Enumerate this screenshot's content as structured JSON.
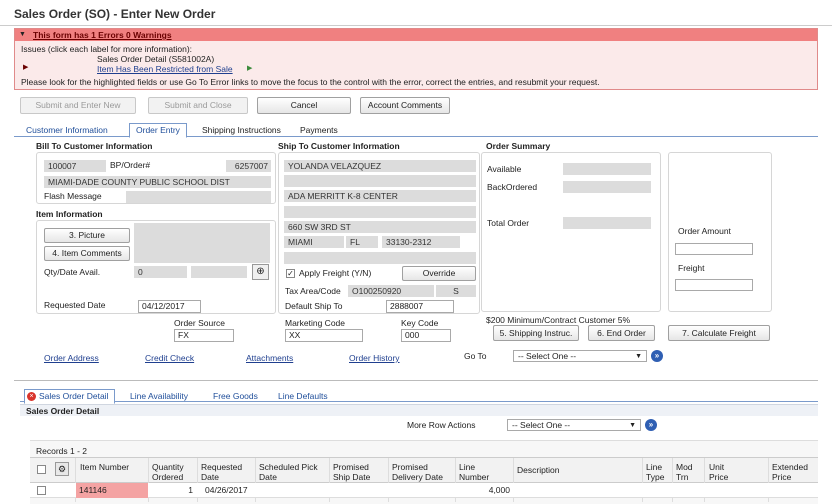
{
  "window": {
    "title": "Sales Order (SO) - Enter New Order"
  },
  "errors": {
    "banner": "This form has 1 Errors 0 Warnings",
    "issues_header": "Issues (click each label for more information):",
    "issue_title": "Sales Order Detail (S581002A)",
    "issue_link": "Item Has Been Restricted from Sale",
    "instruction": "Please look for the highlighted fields or use Go To Error links to move the focus to the control with the error, correct the entries, and resubmit your request."
  },
  "actions": {
    "submit_enter_new": "Submit and Enter New",
    "submit_close": "Submit and Close",
    "cancel": "Cancel",
    "account_comments": "Account Comments"
  },
  "tabs": [
    "Customer Information",
    "Order Entry",
    "Shipping Instructions",
    "Payments"
  ],
  "bill_to": {
    "header": "Bill To Customer Information",
    "customer_no": "100007",
    "bp_label": "BP/Order#",
    "bp_value": "6257007",
    "name": "MIAMI-DADE COUNTY PUBLIC SCHOOL DIST",
    "flash_label": "Flash Message"
  },
  "item_info": {
    "header": "Item Information",
    "picture_btn": "3. Picture",
    "item_comments_btn": "4. Item Comments",
    "qty_label": "Qty/Date Avail.",
    "qty_value": "0",
    "requested_label": "Requested Date",
    "requested_value": "04/12/2017"
  },
  "ship_to": {
    "header": "Ship To Customer Information",
    "name": "YOLANDA VELAZQUEZ",
    "line3": "ADA MERRITT K-8 CENTER",
    "address": "660 SW 3RD ST",
    "city": "MIAMI",
    "state": "FL",
    "zip": "33130-2312",
    "apply_freight": "Apply Freight (Y/N)",
    "override": "Override",
    "tax_label": "Tax Area/Code",
    "tax_value": "O100250920",
    "tax_code": "S",
    "default_ship_label": "Default Ship To",
    "default_ship_value": "2888007"
  },
  "order_summary": {
    "header": "Order Summary",
    "available": "Available",
    "backordered": "BackOrdered",
    "total_order": "Total Order",
    "order_amount": "Order Amount",
    "freight": "Freight"
  },
  "order_fields": {
    "source_label": "Order Source",
    "source_value": "FX",
    "marketing_label": "Marketing Code",
    "marketing_value": "XX",
    "key_label": "Key Code",
    "key_value": "000",
    "minimum_note": "$200 Minimum/Contract Customer 5%",
    "shipping_instruc_btn": "5. Shipping Instruc.",
    "end_order_btn": "6. End Order",
    "calc_freight_btn": "7. Calculate Freight"
  },
  "links": [
    "Order Address",
    "Credit Check",
    "Attachments",
    "Order History"
  ],
  "goto": {
    "label": "Go To",
    "value": "-- Select One --"
  },
  "detail_tabs": [
    "Sales Order Detail",
    "Line Availability",
    "Free Goods",
    "Line Defaults"
  ],
  "detail": {
    "header": "Sales Order Detail",
    "more_row_actions": "More Row Actions",
    "row_select": "-- Select One --",
    "records": "Records 1 - 2",
    "columns": [
      "Item Number",
      "Quantity Ordered",
      "Requested Date",
      "Scheduled Pick Date",
      "Promised Ship Date",
      "Promised Delivery Date",
      "Line Number",
      "Description",
      "Line Type",
      "Mod Trn",
      "Unit Price",
      "Extended Price"
    ],
    "rows": [
      {
        "item": "141146",
        "qty": "1",
        "requested": "04/26/2017",
        "line": "4,000"
      }
    ]
  },
  "colors": {
    "error_banner": "#f08080",
    "tab_link": "#1f4e9a",
    "error_cell": "#f4a3a3"
  }
}
